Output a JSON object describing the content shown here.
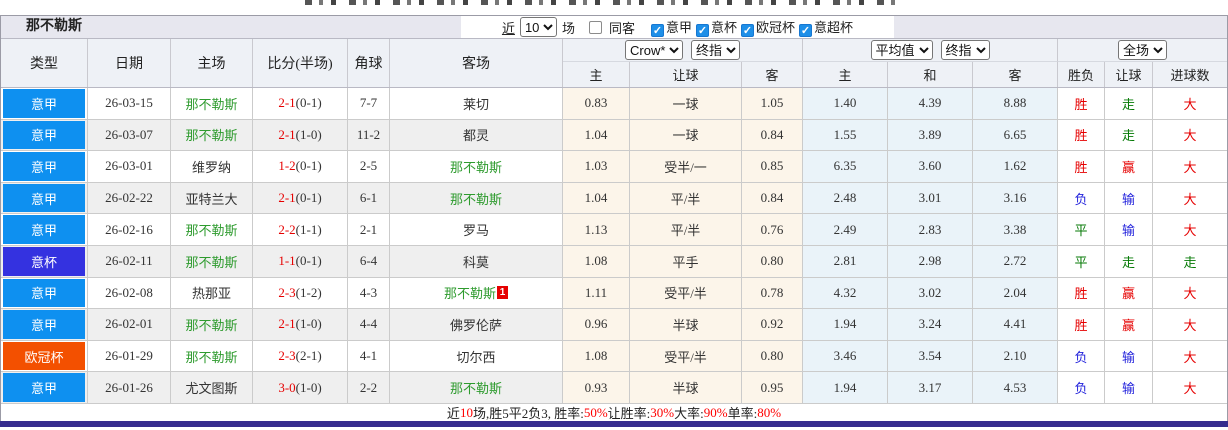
{
  "team_title": "那不勒斯",
  "filter": {
    "recent_label": "近",
    "recent_value": "10",
    "matches_label": "场",
    "same_away": {
      "label": "同客",
      "checked": false
    },
    "leagues": [
      {
        "label": "意甲",
        "checked": true
      },
      {
        "label": "意杯",
        "checked": true
      },
      {
        "label": "欧冠杯",
        "checked": true
      },
      {
        "label": "意超杯",
        "checked": true
      }
    ]
  },
  "selects": {
    "odds_source": "Crow*",
    "odds_time_asian": "终指",
    "euro_source": "平均值",
    "odds_time_euro": "终指",
    "scope": "全场"
  },
  "columns": [
    "类型",
    "日期",
    "主场",
    "比分(半场)",
    "角球",
    "客场"
  ],
  "sub_columns": [
    "主",
    "让球",
    "客",
    "主",
    "和",
    "客",
    "胜负",
    "让球",
    "进球数"
  ],
  "league_colors": {
    "意甲": "#0e90f0",
    "意杯": "#3432e0",
    "欧冠杯": "#f35000"
  },
  "result_colors": {
    "red": "#e60000",
    "green": "#067a06",
    "blue": "#2424dc"
  },
  "team_name_color": "#2e9b2e",
  "rows": [
    {
      "league": "意甲",
      "date": "26-03-15",
      "home": "那不勒斯",
      "home_is_team": true,
      "score": "2-1",
      "half": "(0-1)",
      "corners": "7-7",
      "away": "莱切",
      "away_is_team": false,
      "away_red_cards": null,
      "ah_home": "0.83",
      "handicap": "一球",
      "ah_away": "1.05",
      "eu_home": "1.40",
      "eu_draw": "4.39",
      "eu_away": "8.88",
      "result": [
        "胜",
        "red"
      ],
      "handicap_result": [
        "走",
        "green"
      ],
      "goals": [
        "大",
        "red"
      ]
    },
    {
      "league": "意甲",
      "date": "26-03-07",
      "home": "那不勒斯",
      "home_is_team": true,
      "score": "2-1",
      "half": "(1-0)",
      "corners": "11-2",
      "away": "都灵",
      "away_is_team": false,
      "away_red_cards": null,
      "ah_home": "1.04",
      "handicap": "一球",
      "ah_away": "0.84",
      "eu_home": "1.55",
      "eu_draw": "3.89",
      "eu_away": "6.65",
      "result": [
        "胜",
        "red"
      ],
      "handicap_result": [
        "走",
        "green"
      ],
      "goals": [
        "大",
        "red"
      ]
    },
    {
      "league": "意甲",
      "date": "26-03-01",
      "home": "维罗纳",
      "home_is_team": false,
      "score": "1-2",
      "half": "(0-1)",
      "corners": "2-5",
      "away": "那不勒斯",
      "away_is_team": true,
      "away_red_cards": null,
      "ah_home": "1.03",
      "handicap": "受半/一",
      "ah_away": "0.85",
      "eu_home": "6.35",
      "eu_draw": "3.60",
      "eu_away": "1.62",
      "result": [
        "胜",
        "red"
      ],
      "handicap_result": [
        "赢",
        "red"
      ],
      "goals": [
        "大",
        "red"
      ]
    },
    {
      "league": "意甲",
      "date": "26-02-22",
      "home": "亚特兰大",
      "home_is_team": false,
      "score": "2-1",
      "half": "(0-1)",
      "corners": "6-1",
      "away": "那不勒斯",
      "away_is_team": true,
      "away_red_cards": null,
      "ah_home": "1.04",
      "handicap": "平/半",
      "ah_away": "0.84",
      "eu_home": "2.48",
      "eu_draw": "3.01",
      "eu_away": "3.16",
      "result": [
        "负",
        "blue"
      ],
      "handicap_result": [
        "输",
        "blue"
      ],
      "goals": [
        "大",
        "red"
      ]
    },
    {
      "league": "意甲",
      "date": "26-02-16",
      "home": "那不勒斯",
      "home_is_team": true,
      "score": "2-2",
      "half": "(1-1)",
      "corners": "2-1",
      "away": "罗马",
      "away_is_team": false,
      "away_red_cards": null,
      "ah_home": "1.13",
      "handicap": "平/半",
      "ah_away": "0.76",
      "eu_home": "2.49",
      "eu_draw": "2.83",
      "eu_away": "3.38",
      "result": [
        "平",
        "green"
      ],
      "handicap_result": [
        "输",
        "blue"
      ],
      "goals": [
        "大",
        "red"
      ]
    },
    {
      "league": "意杯",
      "date": "26-02-11",
      "home": "那不勒斯",
      "home_is_team": true,
      "score": "1-1",
      "half": "(0-1)",
      "corners": "6-4",
      "away": "科莫",
      "away_is_team": false,
      "away_red_cards": null,
      "ah_home": "1.08",
      "handicap": "平手",
      "ah_away": "0.80",
      "eu_home": "2.81",
      "eu_draw": "2.98",
      "eu_away": "2.72",
      "result": [
        "平",
        "green"
      ],
      "handicap_result": [
        "走",
        "green"
      ],
      "goals": [
        "走",
        "green"
      ]
    },
    {
      "league": "意甲",
      "date": "26-02-08",
      "home": "热那亚",
      "home_is_team": false,
      "score": "2-3",
      "half": "(1-2)",
      "corners": "4-3",
      "away": "那不勒斯",
      "away_is_team": true,
      "away_red_cards": "1",
      "ah_home": "1.11",
      "handicap": "受平/半",
      "ah_away": "0.78",
      "eu_home": "4.32",
      "eu_draw": "3.02",
      "eu_away": "2.04",
      "result": [
        "胜",
        "red"
      ],
      "handicap_result": [
        "赢",
        "red"
      ],
      "goals": [
        "大",
        "red"
      ]
    },
    {
      "league": "意甲",
      "date": "26-02-01",
      "home": "那不勒斯",
      "home_is_team": true,
      "score": "2-1",
      "half": "(1-0)",
      "corners": "4-4",
      "away": "佛罗伦萨",
      "away_is_team": false,
      "away_red_cards": null,
      "ah_home": "0.96",
      "handicap": "半球",
      "ah_away": "0.92",
      "eu_home": "1.94",
      "eu_draw": "3.24",
      "eu_away": "4.41",
      "result": [
        "胜",
        "red"
      ],
      "handicap_result": [
        "赢",
        "red"
      ],
      "goals": [
        "大",
        "red"
      ]
    },
    {
      "league": "欧冠杯",
      "date": "26-01-29",
      "home": "那不勒斯",
      "home_is_team": true,
      "score": "2-3",
      "half": "(2-1)",
      "corners": "4-1",
      "away": "切尔西",
      "away_is_team": false,
      "away_red_cards": null,
      "ah_home": "1.08",
      "handicap": "受平/半",
      "ah_away": "0.80",
      "eu_home": "3.46",
      "eu_draw": "3.54",
      "eu_away": "2.10",
      "result": [
        "负",
        "blue"
      ],
      "handicap_result": [
        "输",
        "blue"
      ],
      "goals": [
        "大",
        "red"
      ]
    },
    {
      "league": "意甲",
      "date": "26-01-26",
      "home": "尤文图斯",
      "home_is_team": false,
      "score": "3-0",
      "half": "(1-0)",
      "corners": "2-2",
      "away": "那不勒斯",
      "away_is_team": true,
      "away_red_cards": null,
      "ah_home": "0.93",
      "handicap": "半球",
      "ah_away": "0.95",
      "eu_home": "1.94",
      "eu_draw": "3.17",
      "eu_away": "4.53",
      "result": [
        "负",
        "blue"
      ],
      "handicap_result": [
        "输",
        "blue"
      ],
      "goals": [
        "大",
        "red"
      ]
    }
  ],
  "footer_segments": [
    {
      "text": "近",
      "color": "dark"
    },
    {
      "text": "10",
      "color": "red"
    },
    {
      "text": "场,胜5平2负3, 胜率:",
      "color": "dark"
    },
    {
      "text": "50%",
      "color": "red"
    },
    {
      "text": " 让胜率:",
      "color": "dark"
    },
    {
      "text": "30%",
      "color": "red"
    },
    {
      "text": " 大率:",
      "color": "dark"
    },
    {
      "text": "90%",
      "color": "red"
    },
    {
      "text": " 单率:",
      "color": "dark"
    },
    {
      "text": "80%",
      "color": "red"
    }
  ]
}
